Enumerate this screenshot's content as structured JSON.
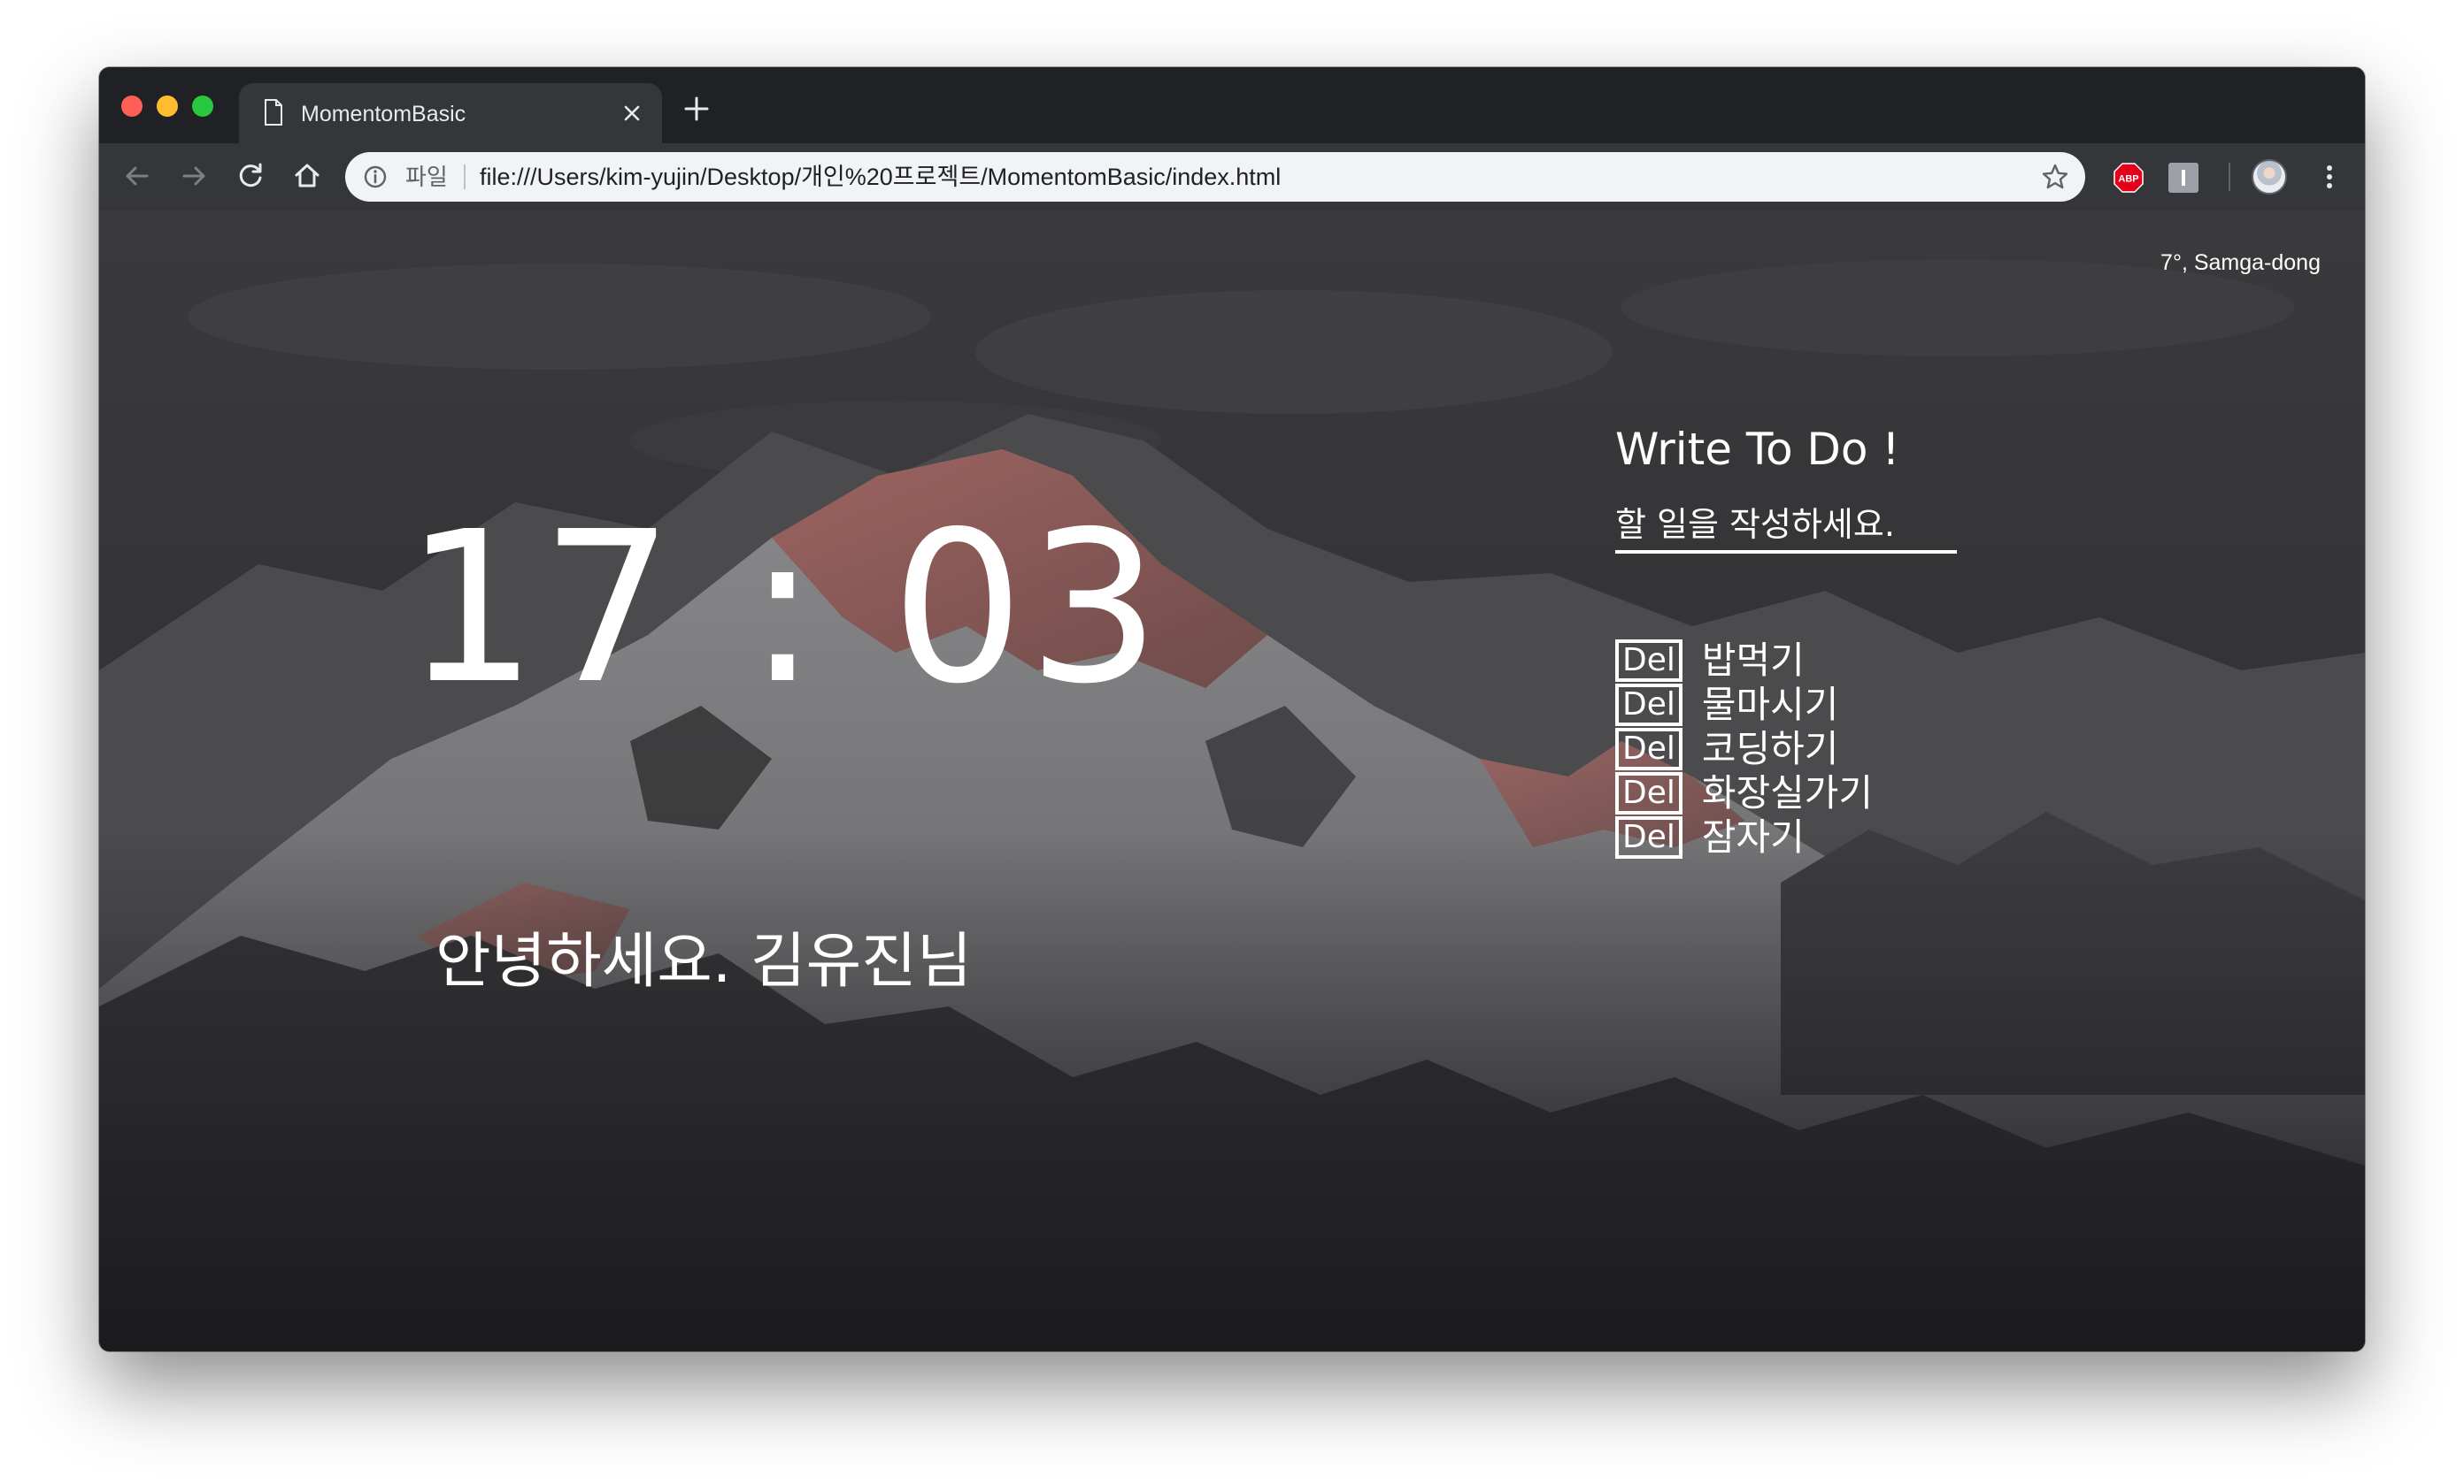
{
  "browser": {
    "tab_title": "MomentomBasic",
    "scheme_label": "파일",
    "url": "file:///Users/kim-yujin/Desktop/개인%20프로젝트/MomentomBasic/index.html",
    "extension_badge": "ABP",
    "icons": {
      "tab": "document-icon",
      "tab_close": "close-icon",
      "new_tab": "plus-icon",
      "back": "arrow-left-icon",
      "forward": "arrow-right-icon",
      "reload": "reload-icon",
      "home": "home-icon",
      "site_info": "info-icon",
      "bookmark": "star-icon",
      "menu": "more-vertical-icon"
    },
    "traffic_lights": {
      "close": "#ff5f57",
      "minimize": "#febc2e",
      "maximize": "#28c840"
    }
  },
  "weather": {
    "text": "7°, Samga-dong"
  },
  "clock": {
    "time": "17 : 03"
  },
  "greeting": {
    "text": "안녕하세요. 김유진님"
  },
  "todo": {
    "title": "Write To Do !",
    "input_placeholder": "할 일을 작성하세요.",
    "delete_label": "Del",
    "items": [
      {
        "text": "밥먹기"
      },
      {
        "text": "물마시기"
      },
      {
        "text": "코딩하기"
      },
      {
        "text": "화장실가기"
      },
      {
        "text": "잠자기"
      }
    ]
  }
}
